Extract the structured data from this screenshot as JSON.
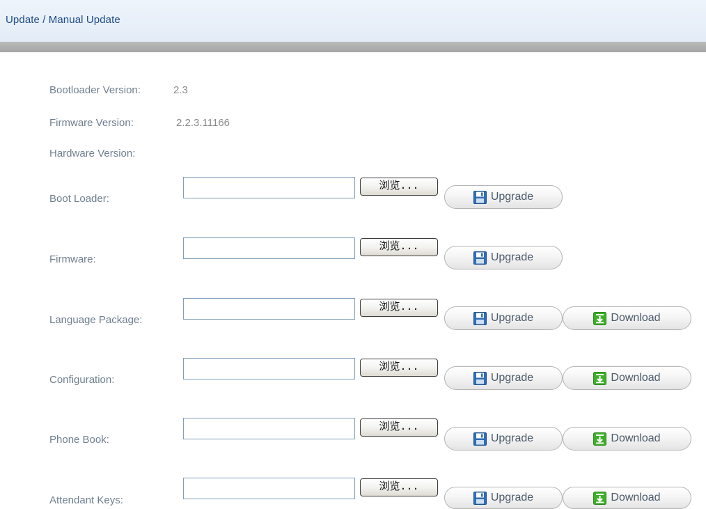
{
  "header": {
    "title": "Update / Manual Update"
  },
  "versions": {
    "bootloader": {
      "label": "Bootloader Version:",
      "value": "2.3"
    },
    "firmware": {
      "label": "Firmware Version:",
      "value": "2.2.3.11166"
    },
    "hardware": {
      "label": "Hardware Version:",
      "value": ""
    }
  },
  "rows": [
    {
      "label": "Boot Loader:",
      "file_value": "",
      "browse_label": "浏览...",
      "upgrade_label": "Upgrade"
    },
    {
      "label": "Firmware:",
      "file_value": "",
      "browse_label": "浏览...",
      "upgrade_label": "Upgrade"
    },
    {
      "label": "Language Package:",
      "file_value": "",
      "browse_label": "浏览...",
      "upgrade_label": "Upgrade",
      "download_label": "Download"
    },
    {
      "label": "Configuration:",
      "file_value": "",
      "browse_label": "浏览...",
      "upgrade_label": "Upgrade",
      "download_label": "Download"
    },
    {
      "label": "Phone Book:",
      "file_value": "",
      "browse_label": "浏览...",
      "upgrade_label": "Upgrade",
      "download_label": "Download"
    },
    {
      "label": "Attendant Keys:",
      "file_value": "",
      "browse_label": "浏览...",
      "upgrade_label": "Upgrade",
      "download_label": "Download"
    }
  ],
  "icons": {
    "upgrade": "floppy-disk-icon",
    "download": "download-arrow-icon"
  },
  "colors": {
    "header_text": "#1d4a8a",
    "label_text": "#6f7f8f",
    "value_text": "#8a8a8a",
    "upgrade_icon": "#2e6db4",
    "download_icon": "#3fae2a"
  }
}
